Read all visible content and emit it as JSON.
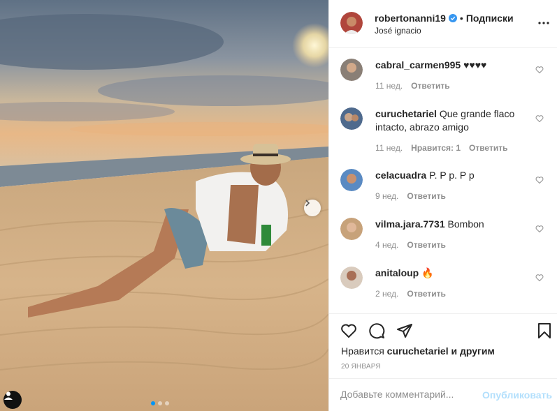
{
  "colors": {
    "accent": "#0095f6",
    "publish_disabled": "#b2dffc",
    "muted": "#8e8e8e",
    "text": "#262626"
  },
  "post": {
    "image": {
      "alt": "photo",
      "carousel_count": 3,
      "active_index": 0
    }
  },
  "header": {
    "username": "robertonanni19",
    "verified": true,
    "separator": "•",
    "follow_label": "Подписки",
    "location": "José ignacio",
    "more_icon": "ellipsis-icon"
  },
  "comments": [
    {
      "user": "cabral_carmen995",
      "text": "♥♥♥♥",
      "time": "11 нед.",
      "likes": "",
      "reply": "Ответить"
    },
    {
      "user": "curuchetariel",
      "text": "Que grande flaco intacto, abrazo amigo",
      "time": "11 нед.",
      "likes": "Нравится: 1",
      "reply": "Ответить"
    },
    {
      "user": "celacuadra",
      "text": "P. P p. P p",
      "time": "9 нед.",
      "likes": "",
      "reply": "Ответить"
    },
    {
      "user": "vilma.jara.7731",
      "text": "Bombon",
      "time": "4 нед.",
      "likes": "",
      "reply": "Ответить"
    },
    {
      "user": "anitaloup",
      "text": "🔥",
      "time": "2 нед.",
      "likes": "",
      "reply": "Ответить"
    }
  ],
  "actions": {
    "like_icon": "heart-icon",
    "comment_icon": "comment-icon",
    "share_icon": "share-icon",
    "save_icon": "bookmark-icon"
  },
  "likes_line": {
    "prefix": "Нравится",
    "user": "curuchetariel",
    "suffix": "и другим"
  },
  "date": "20 ЯНВАРЯ",
  "add_comment": {
    "placeholder": "Добавьте комментарий...",
    "publish_label": "Опубликовать"
  }
}
